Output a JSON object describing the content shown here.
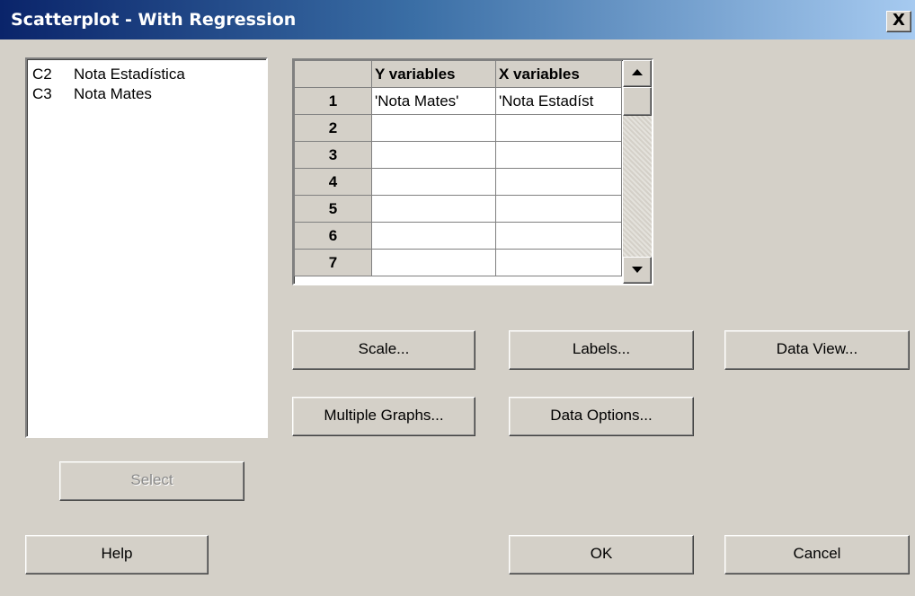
{
  "window": {
    "title": "Scatterplot - With Regression",
    "close_label": "X"
  },
  "variable_list": {
    "items": [
      {
        "column": "C2",
        "name": "Nota Estadística"
      },
      {
        "column": "C3",
        "name": "Nota Mates"
      }
    ]
  },
  "variables_grid": {
    "headers": [
      "Y variables",
      "X variables"
    ],
    "rows": [
      {
        "num": "1",
        "y": "'Nota Mates'",
        "x": "'Nota Estadíst"
      },
      {
        "num": "2",
        "y": "",
        "x": ""
      },
      {
        "num": "3",
        "y": "",
        "x": ""
      },
      {
        "num": "4",
        "y": "",
        "x": ""
      },
      {
        "num": "5",
        "y": "",
        "x": ""
      },
      {
        "num": "6",
        "y": "",
        "x": ""
      },
      {
        "num": "7",
        "y": "",
        "x": ""
      }
    ]
  },
  "buttons": {
    "scale": "Scale...",
    "labels": "Labels...",
    "data_view": "Data View...",
    "multiple_graphs": "Multiple Graphs...",
    "data_options": "Data Options...",
    "select": "Select",
    "help": "Help",
    "ok": "OK",
    "cancel": "Cancel"
  },
  "colors": {
    "titlebar_start": "#0a246a",
    "titlebar_end": "#a6caf0",
    "dialog_bg": "#d4d0c8",
    "disabled_text": "#8a8a8a"
  }
}
